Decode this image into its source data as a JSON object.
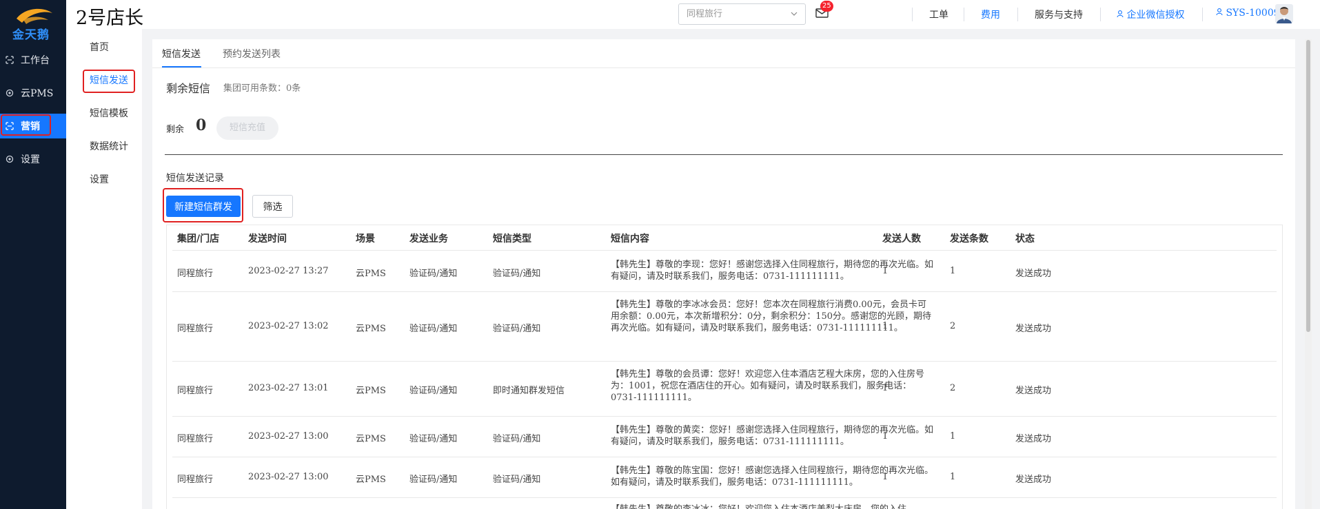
{
  "brand": {
    "logo_text": "金天鹅"
  },
  "sidebar": {
    "items": [
      {
        "label": "工作台",
        "icon": "workbench-icon"
      },
      {
        "label": "云PMS",
        "icon": "gear-icon"
      },
      {
        "label": "营销",
        "icon": "marketing-icon",
        "active": true
      },
      {
        "label": "设置",
        "icon": "gear-icon"
      }
    ]
  },
  "header": {
    "store_title": "2号店长",
    "store_select": {
      "placeholder": "同程旅行"
    },
    "mail_badge": "25",
    "nav": {
      "workorder": "工单",
      "fees": "费用",
      "service": "服务与支持",
      "wechat": "企业微信授权",
      "user": "SYS-10009"
    }
  },
  "submenu": {
    "items": [
      "首页",
      "短信发送",
      "短信模板",
      "数据统计",
      "设置"
    ],
    "active_index": 1
  },
  "tabs": [
    "短信发送",
    "预约发送列表"
  ],
  "balance": {
    "title": "剩余短信",
    "group_available": "集团可用条数：0条",
    "remain_label": "剩余",
    "remain_value": "0",
    "recharge_label": "短信充值"
  },
  "records": {
    "title": "短信发送记录",
    "new_button": "新建短信群发",
    "filter_button": "筛选",
    "columns": [
      "集团/门店",
      "发送时间",
      "场景",
      "发送业务",
      "短信类型",
      "短信内容",
      "发送人数",
      "发送条数",
      "状态"
    ],
    "rows": [
      {
        "store": "同程旅行",
        "time": "2023-02-27 13:27",
        "scene": "云PMS",
        "business": "验证码/通知",
        "type": "验证码/通知",
        "content": "【韩先生】尊敬的李现：您好！感谢您选择入住同程旅行，期待您的再次光临。如有疑问，请及时联系我们，服务电话：0731-111111111。",
        "people": "1",
        "count": "1",
        "status": "发送成功"
      },
      {
        "store": "同程旅行",
        "time": "2023-02-27 13:02",
        "scene": "云PMS",
        "business": "验证码/通知",
        "type": "验证码/通知",
        "content": "【韩先生】尊敬的李冰冰会员：您好！您本次在同程旅行消费0.00元，会员卡可用余额：0.00元，本次新增积分：0分，剩余积分：150分。感谢您的光顾，期待再次光临。如有疑问，请及时联系我们，服务电话：0731-111111111。",
        "people": "1",
        "count": "2",
        "status": "发送成功"
      },
      {
        "store": "同程旅行",
        "time": "2023-02-27 13:01",
        "scene": "云PMS",
        "business": "验证码/通知",
        "type": "即时通知群发短信",
        "content": "【韩先生】尊敬的会员谭：您好！欢迎您入住本酒店艺程大床房，您的入住房号为：1001，祝您在酒店住的开心。如有疑问，请及时联系我们，服务电话：0731-111111111。",
        "people": "1",
        "count": "2",
        "status": "发送成功"
      },
      {
        "store": "同程旅行",
        "time": "2023-02-27 13:00",
        "scene": "云PMS",
        "business": "验证码/通知",
        "type": "验证码/通知",
        "content": "【韩先生】尊敬的黄奕：您好！感谢您选择入住同程旅行，期待您的再次光临。如有疑问，请及时联系我们，服务电话：0731-111111111。",
        "people": "1",
        "count": "1",
        "status": "发送成功"
      },
      {
        "store": "同程旅行",
        "time": "2023-02-27 13:00",
        "scene": "云PMS",
        "business": "验证码/通知",
        "type": "验证码/通知",
        "content": "【韩先生】尊敬的陈宝国：您好！感谢您选择入住同程旅行，期待您的再次光临。如有疑问，请及时联系我们，服务电话：0731-111111111。",
        "people": "1",
        "count": "1",
        "status": "发送成功"
      },
      {
        "store": "",
        "time": "",
        "scene": "",
        "business": "",
        "type": "",
        "content": "【韩先生】尊敬的李冰冰：您好！欢迎您入住本酒店美梨大床房，您的入住",
        "people": "",
        "count": "",
        "status": ""
      }
    ]
  },
  "colors": {
    "accent": "#1677ff",
    "sidebar_bg": "#0e1b2e",
    "highlight": "#e02020",
    "badge": "#f5222d"
  }
}
